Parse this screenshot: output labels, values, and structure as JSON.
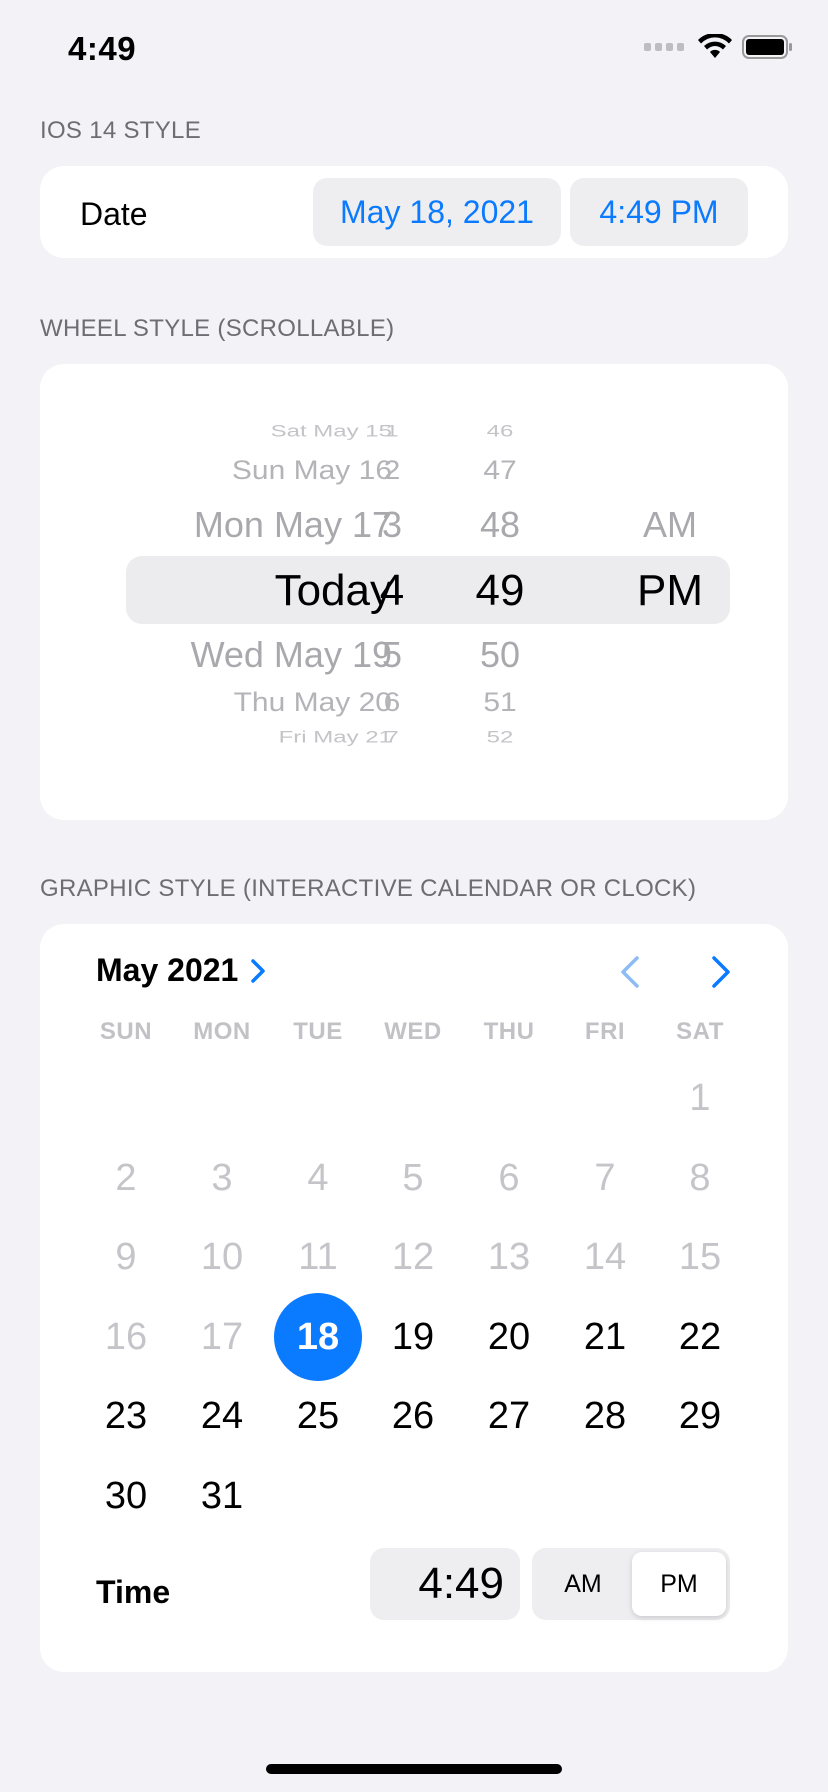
{
  "status_bar": {
    "time": "4:49"
  },
  "sections": {
    "ios14": "IOS 14 STYLE",
    "wheel": "WHEEL STYLE (SCROLLABLE)",
    "graphic": "GRAPHIC STYLE (INTERACTIVE CALENDAR OR CLOCK)"
  },
  "compact": {
    "label": "Date",
    "date_value": "May 18, 2021",
    "time_value": "4:49 PM"
  },
  "wheel": {
    "rows": [
      {
        "date": "Sat May 15",
        "hour": "1",
        "minute": "46",
        "ampm": ""
      },
      {
        "date": "Sun May 16",
        "hour": "2",
        "minute": "47",
        "ampm": ""
      },
      {
        "date": "Mon May 17",
        "hour": "3",
        "minute": "48",
        "ampm": "AM"
      },
      {
        "date": "Today",
        "hour": "4",
        "minute": "49",
        "ampm": "PM"
      },
      {
        "date": "Wed May 19",
        "hour": "5",
        "minute": "50",
        "ampm": ""
      },
      {
        "date": "Thu May 20",
        "hour": "6",
        "minute": "51",
        "ampm": ""
      },
      {
        "date": "Fri May 21",
        "hour": "7",
        "minute": "52",
        "ampm": ""
      }
    ]
  },
  "calendar": {
    "month_label": "May 2021",
    "weekdays": [
      "SUN",
      "MON",
      "TUE",
      "WED",
      "THU",
      "FRI",
      "SAT"
    ],
    "days": [
      "1",
      "2",
      "3",
      "4",
      "5",
      "6",
      "7",
      "8",
      "9",
      "10",
      "11",
      "12",
      "13",
      "14",
      "15",
      "16",
      "17",
      "18",
      "19",
      "20",
      "21",
      "22",
      "23",
      "24",
      "25",
      "26",
      "27",
      "28",
      "29",
      "30",
      "31"
    ],
    "selected_day": "18",
    "accent_color": "#0A7AFF"
  },
  "time_picker": {
    "label": "Time",
    "value": "4:49",
    "am_label": "AM",
    "pm_label": "PM",
    "selected": "PM"
  }
}
